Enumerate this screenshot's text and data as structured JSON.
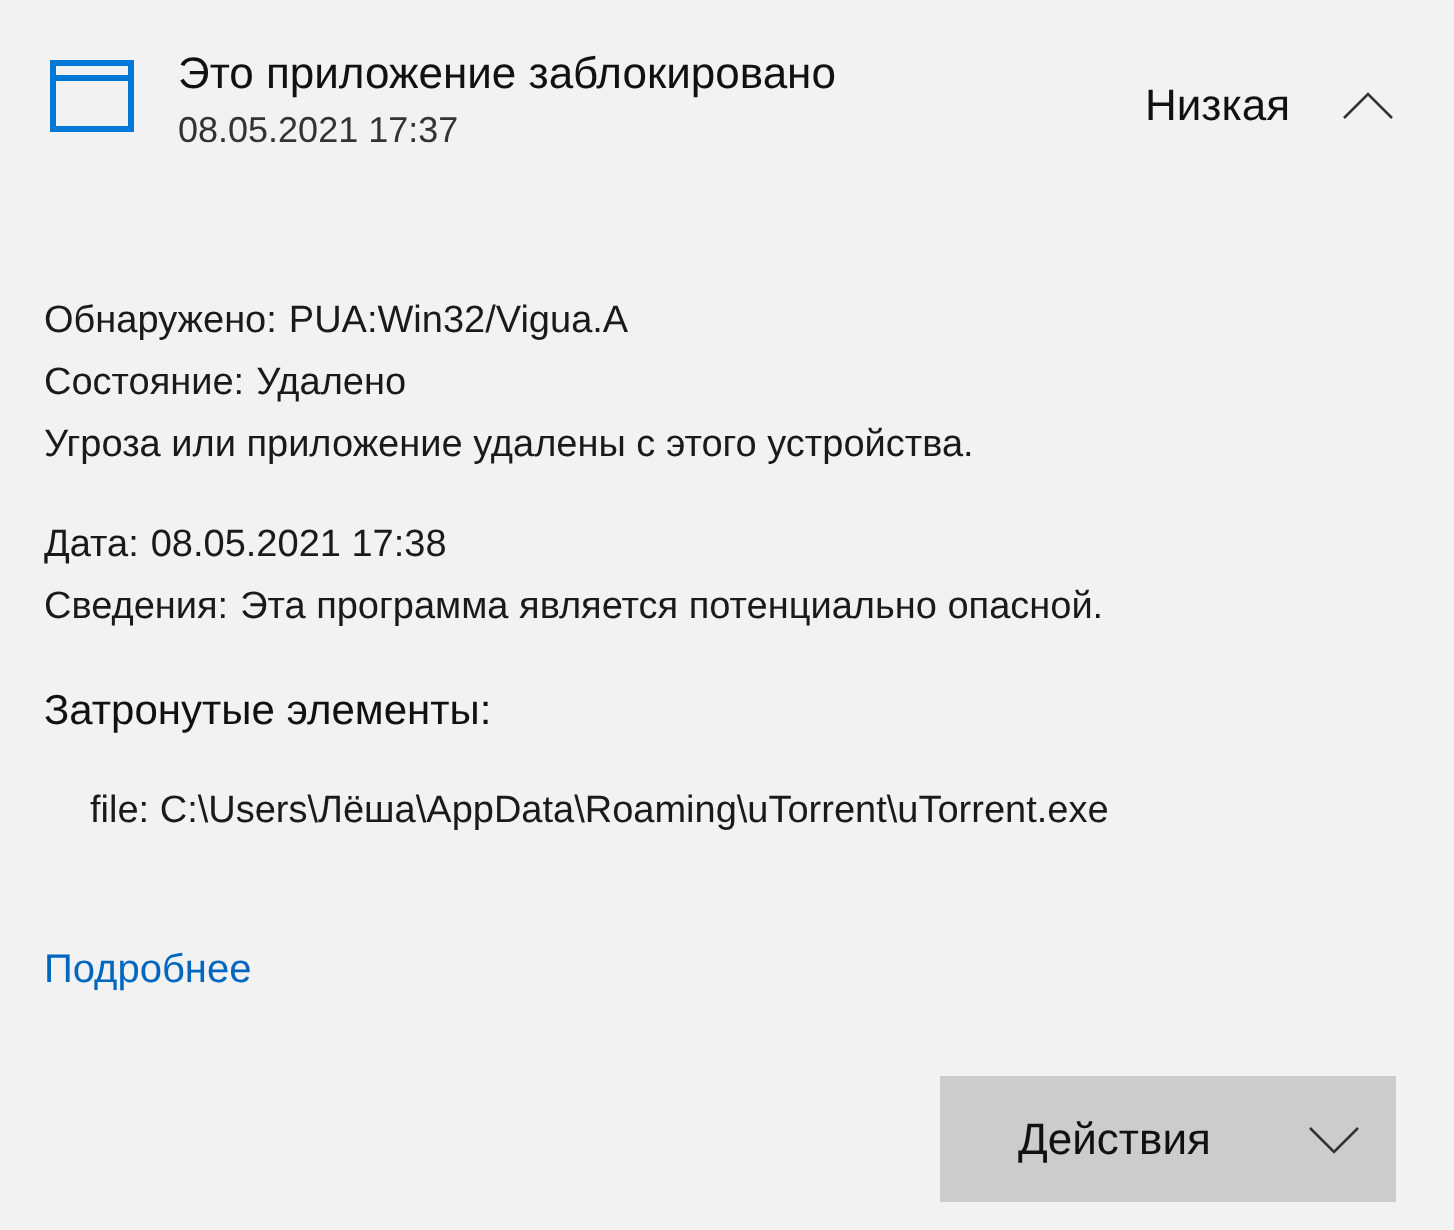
{
  "header": {
    "title": "Это приложение заблокировано",
    "date": "08.05.2021 17:37",
    "severity": "Низкая",
    "expanded": true
  },
  "details": [
    {
      "label": "Обнаружено:",
      "value": "PUA:Win32/Vigua.A"
    },
    {
      "label": "Состояние:",
      "value": "Удалено"
    }
  ],
  "description": "Угроза или приложение удалены с этого устройства.",
  "info": [
    {
      "label": "Дата:",
      "value": "08.05.2021 17:38"
    },
    {
      "label": "Сведения:",
      "value": "Эта программа является потенциально опасной."
    }
  ],
  "affected": {
    "heading": "Затронутые элементы:",
    "items": [
      "file: C:\\Users\\Лёша\\AppData\\Roaming\\uTorrent\\uTorrent.exe"
    ]
  },
  "link": "Подробнее",
  "actions_button": {
    "label": "Действия",
    "expanded": false
  }
}
